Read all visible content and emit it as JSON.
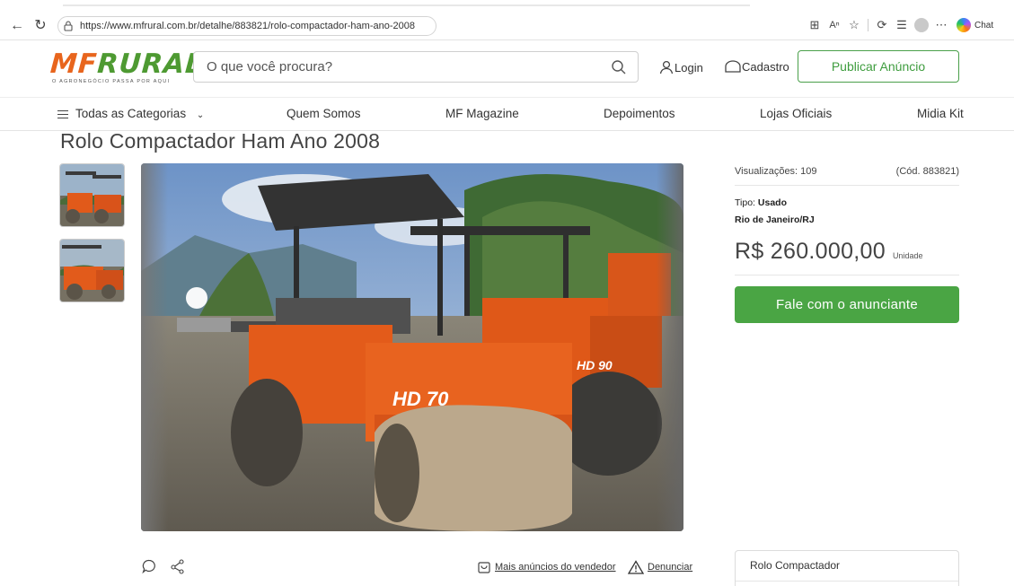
{
  "browser": {
    "url": "https://www.mfrural.com.br/detalhe/883821/rolo-compactador-ham-ano-2008",
    "chat_label": "Chat"
  },
  "header": {
    "logo_mf": "MF",
    "logo_rural": "RURAL",
    "logo_tagline": "O AGRONEGÓCIO PASSA POR AQUI",
    "search_placeholder": "O que você procura?",
    "login_label": "Login",
    "signup_label": "Cadastro",
    "publish_label": "Publicar Anúncio"
  },
  "nav": {
    "items": [
      "Todas as Categorias",
      "Quem Somos",
      "MF Magazine",
      "Depoimentos",
      "Lojas Oficiais",
      "Midia Kit"
    ]
  },
  "product": {
    "title": "Rolo Compactador Ham Ano 2008",
    "image_labels": [
      "HD 70",
      "HD 90"
    ]
  },
  "info": {
    "views": "Visualizações: 109",
    "code": "(Cód. 883821)",
    "type_label": "Tipo:",
    "type_value": "Usado",
    "location": "Rio de Janeiro/RJ",
    "price": "R$ 260.000,00",
    "price_unit": "Unidade",
    "contact_label": "Fale com o anunciante"
  },
  "actions": {
    "more_ads": "Mais anúncios do vendedor",
    "report": "Denunciar"
  },
  "side_card": {
    "title": "Rolo Compactador"
  },
  "colors": {
    "brand_orange": "#e8651d",
    "brand_green": "#4e9a32",
    "cta_green": "#4aa544"
  }
}
